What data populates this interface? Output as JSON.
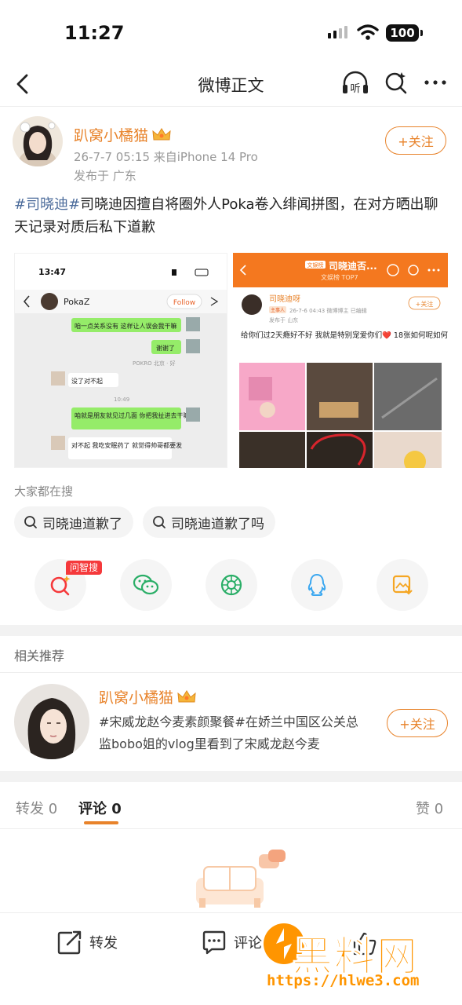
{
  "status_bar": {
    "time": "11:27",
    "battery": "100"
  },
  "nav": {
    "title": "微博正文",
    "listen_label": "听"
  },
  "post": {
    "author": "趴窝小橘猫",
    "time_source": "26-7-7 05:15  来自iPhone 14 Pro",
    "location": "发布于 广东",
    "follow_label": "+关注",
    "tag": "#司晓迪#",
    "text": "司晓迪因擅自将圈外人Poka卷入绯闻拼图，在对方晒出聊天记录对质后私下道歉"
  },
  "image1": {
    "time": "13:47",
    "contact": "PokaZ",
    "follow": "Follow",
    "messages": [
      {
        "side": "right",
        "text": "咱一点关系没有 这样让人误会我干嘛"
      },
      {
        "side": "right",
        "text": "谢谢了"
      },
      {
        "side": "meta",
        "text": "POKRO 北京 · 好"
      },
      {
        "side": "left",
        "text": "没了对不起"
      },
      {
        "side": "meta",
        "text": "10:49"
      },
      {
        "side": "right",
        "text": "咱就是朋友就见过几面 你把我扯进去干嘛"
      },
      {
        "side": "left",
        "text": "对不起 我吃安眠药了 就觉得帅哥都要发"
      }
    ]
  },
  "image2": {
    "badge": "文娱榜",
    "title": "司晓迪否...",
    "subtitle": "文娱榜 TOP7",
    "author": "司晓迪呀",
    "meta": "26-7-6 04:43  微博博主  已编辑",
    "tag": "主事人",
    "location": "发布于 山东",
    "follow": "+关注",
    "text": "给你们过2天瘾好不好 我就是特别宠爱你们❤️ 18张如何呢如何呢🧡"
  },
  "search_section": {
    "label": "大家都在搜",
    "chips": [
      "司晓迪道歉了",
      "司晓迪道歉了吗"
    ]
  },
  "share": {
    "ai_badge": "问智搜"
  },
  "related": {
    "label": "相关推荐",
    "author": "趴窝小橘猫",
    "text": "#宋威龙赵今麦素颜聚餐#在娇兰中国区公关总监bobo姐的vlog里看到了宋威龙赵今麦",
    "follow_label": "+关注"
  },
  "tabs": {
    "repost": "转发 0",
    "comment": "评论 0",
    "like": "赞 0"
  },
  "bottom_bar": {
    "repost": "转发",
    "comment": "评论"
  },
  "watermark": {
    "text": "黑料网",
    "url": "https://hlwe3.com"
  },
  "colors": {
    "accent": "#e8832b",
    "tag": "#4a6a9a",
    "badge_red": "#f5393b"
  }
}
